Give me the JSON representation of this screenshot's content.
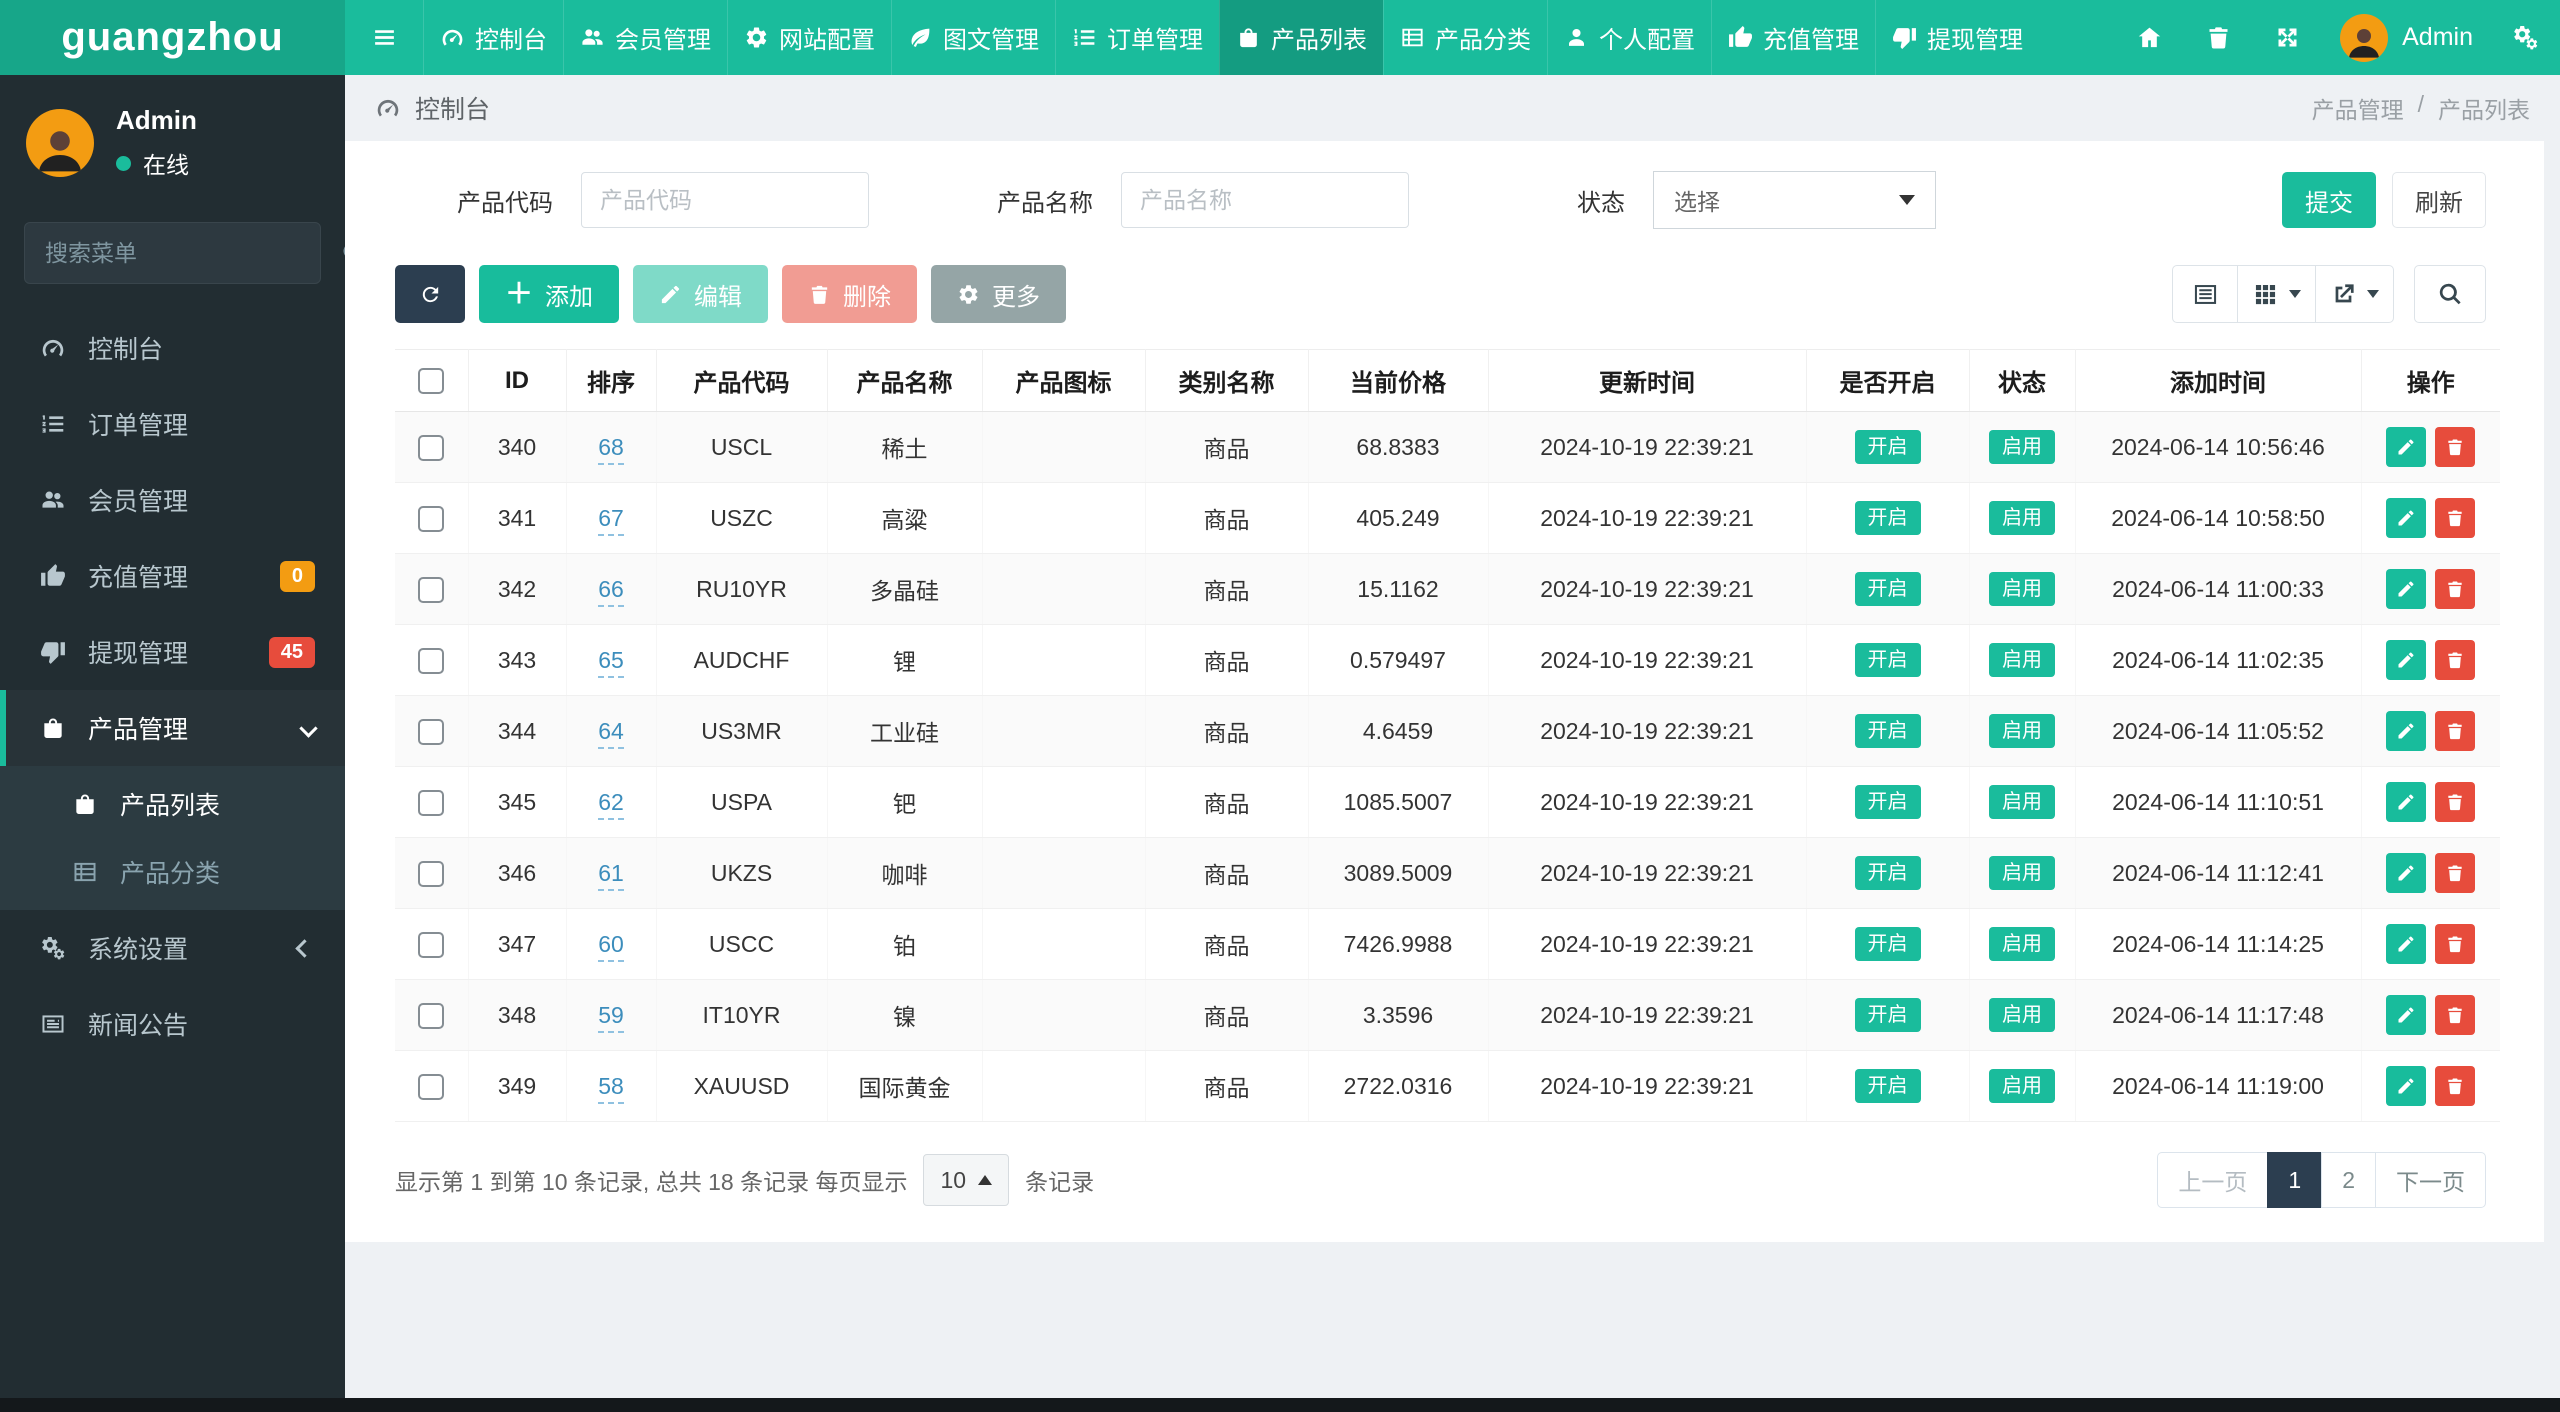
{
  "navbar": {
    "logo": "guangzhou",
    "user_label": "Admin",
    "items": [
      {
        "key": "dashboard",
        "icon": "dashboard",
        "label": "控制台"
      },
      {
        "key": "members",
        "icon": "users",
        "label": "会员管理"
      },
      {
        "key": "site-config",
        "icon": "gear",
        "label": "网站配置"
      },
      {
        "key": "content",
        "icon": "leaf",
        "label": "图文管理"
      },
      {
        "key": "orders",
        "icon": "list-ol",
        "label": "订单管理"
      },
      {
        "key": "product-list",
        "icon": "bag",
        "label": "产品列表",
        "active": true
      },
      {
        "key": "product-category",
        "icon": "table",
        "label": "产品分类"
      },
      {
        "key": "profile",
        "icon": "person",
        "label": "个人配置"
      },
      {
        "key": "recharge",
        "icon": "thumbs-up",
        "label": "充值管理"
      },
      {
        "key": "withdraw",
        "icon": "thumbs-down",
        "label": "提现管理"
      }
    ]
  },
  "sidebar": {
    "user": {
      "name": "Admin",
      "status": "在线"
    },
    "search_placeholder": "搜索菜单",
    "items": [
      {
        "key": "dashboard",
        "icon": "dashboard",
        "label": "控制台"
      },
      {
        "key": "orders",
        "icon": "list-ol",
        "label": "订单管理"
      },
      {
        "key": "members",
        "icon": "users",
        "label": "会员管理"
      },
      {
        "key": "recharge",
        "icon": "thumbs-up",
        "label": "充值管理",
        "badge": "0",
        "badge_color": "#f39c12"
      },
      {
        "key": "withdraw",
        "icon": "thumbs-down",
        "label": "提现管理",
        "badge": "45",
        "badge_color": "#e74c3c"
      },
      {
        "key": "products",
        "icon": "bag",
        "label": "产品管理",
        "active": true,
        "arrow": "down",
        "children": [
          {
            "key": "product-list",
            "icon": "bag",
            "label": "产品列表",
            "active": true
          },
          {
            "key": "product-category",
            "icon": "table",
            "label": "产品分类"
          }
        ]
      },
      {
        "key": "system",
        "icon": "gears",
        "label": "系统设置",
        "arrow": "left"
      },
      {
        "key": "news",
        "icon": "news",
        "label": "新闻公告"
      }
    ]
  },
  "breadcrumb": {
    "left": "控制台",
    "parent": "产品管理",
    "separator": "/",
    "current": "产品列表"
  },
  "filters": {
    "code_label": "产品代码",
    "code_placeholder": "产品代码",
    "name_label": "产品名称",
    "name_placeholder": "产品名称",
    "status_label": "状态",
    "status_value": "选择",
    "submit": "提交",
    "refresh": "刷新"
  },
  "toolbar": {
    "add": "添加",
    "edit": "编辑",
    "delete": "删除",
    "more": "更多"
  },
  "table": {
    "headers": [
      "ID",
      "排序",
      "产品代码",
      "产品名称",
      "产品图标",
      "类别名称",
      "当前价格",
      "更新时间",
      "是否开启",
      "状态",
      "添加时间",
      "操作"
    ],
    "rows": [
      {
        "id": "340",
        "sort": "68",
        "code": "USCL",
        "name": "稀土",
        "icon": "",
        "category": "商品",
        "price": "68.8383",
        "updated": "2024-10-19 22:39:21",
        "enabled": "开启",
        "status": "启用",
        "added": "2024-06-14 10:56:46"
      },
      {
        "id": "341",
        "sort": "67",
        "code": "USZC",
        "name": "高粱",
        "icon": "",
        "category": "商品",
        "price": "405.249",
        "updated": "2024-10-19 22:39:21",
        "enabled": "开启",
        "status": "启用",
        "added": "2024-06-14 10:58:50"
      },
      {
        "id": "342",
        "sort": "66",
        "code": "RU10YR",
        "name": "多晶硅",
        "icon": "",
        "category": "商品",
        "price": "15.1162",
        "updated": "2024-10-19 22:39:21",
        "enabled": "开启",
        "status": "启用",
        "added": "2024-06-14 11:00:33"
      },
      {
        "id": "343",
        "sort": "65",
        "code": "AUDCHF",
        "name": "锂",
        "icon": "",
        "category": "商品",
        "price": "0.579497",
        "updated": "2024-10-19 22:39:21",
        "enabled": "开启",
        "status": "启用",
        "added": "2024-06-14 11:02:35"
      },
      {
        "id": "344",
        "sort": "64",
        "code": "US3MR",
        "name": "工业硅",
        "icon": "",
        "category": "商品",
        "price": "4.6459",
        "updated": "2024-10-19 22:39:21",
        "enabled": "开启",
        "status": "启用",
        "added": "2024-06-14 11:05:52"
      },
      {
        "id": "345",
        "sort": "62",
        "code": "USPA",
        "name": "钯",
        "icon": "",
        "category": "商品",
        "price": "1085.5007",
        "updated": "2024-10-19 22:39:21",
        "enabled": "开启",
        "status": "启用",
        "added": "2024-06-14 11:10:51"
      },
      {
        "id": "346",
        "sort": "61",
        "code": "UKZS",
        "name": "咖啡",
        "icon": "",
        "category": "商品",
        "price": "3089.5009",
        "updated": "2024-10-19 22:39:21",
        "enabled": "开启",
        "status": "启用",
        "added": "2024-06-14 11:12:41"
      },
      {
        "id": "347",
        "sort": "60",
        "code": "USCC",
        "name": "铂",
        "icon": "",
        "category": "商品",
        "price": "7426.9988",
        "updated": "2024-10-19 22:39:21",
        "enabled": "开启",
        "status": "启用",
        "added": "2024-06-14 11:14:25"
      },
      {
        "id": "348",
        "sort": "59",
        "code": "IT10YR",
        "name": "镍",
        "icon": "",
        "category": "商品",
        "price": "3.3596",
        "updated": "2024-10-19 22:39:21",
        "enabled": "开启",
        "status": "启用",
        "added": "2024-06-14 11:17:48"
      },
      {
        "id": "349",
        "sort": "58",
        "code": "XAUUSD",
        "name": "国际黄金",
        "icon": "",
        "category": "商品",
        "price": "2722.0316",
        "updated": "2024-10-19 22:39:21",
        "enabled": "开启",
        "status": "启用",
        "added": "2024-06-14 11:19:00"
      }
    ]
  },
  "pagination": {
    "info_prefix": "显示第 1 到第 10 条记录, 总共 18 条记录 每页显示",
    "page_size": "10",
    "info_suffix": "条记录",
    "prev": "上一页",
    "pages": [
      "1",
      "2"
    ],
    "active_page": "1",
    "next": "下一页"
  },
  "colors": {
    "primary": "#1abc9c",
    "navbar_bg": "#1abc9c",
    "navbar_logo_bg": "#17a689",
    "navbar_active": "#149c81",
    "sidebar_bg": "#222d32",
    "submenu_bg": "#2c3b41",
    "dark_button": "#2c3e50",
    "danger": "#e74c3c",
    "warning_badge": "#f39c12",
    "muted_button": "#95a5a6",
    "sort_link": "#3c8dbc",
    "stripe": "#fafafa"
  }
}
